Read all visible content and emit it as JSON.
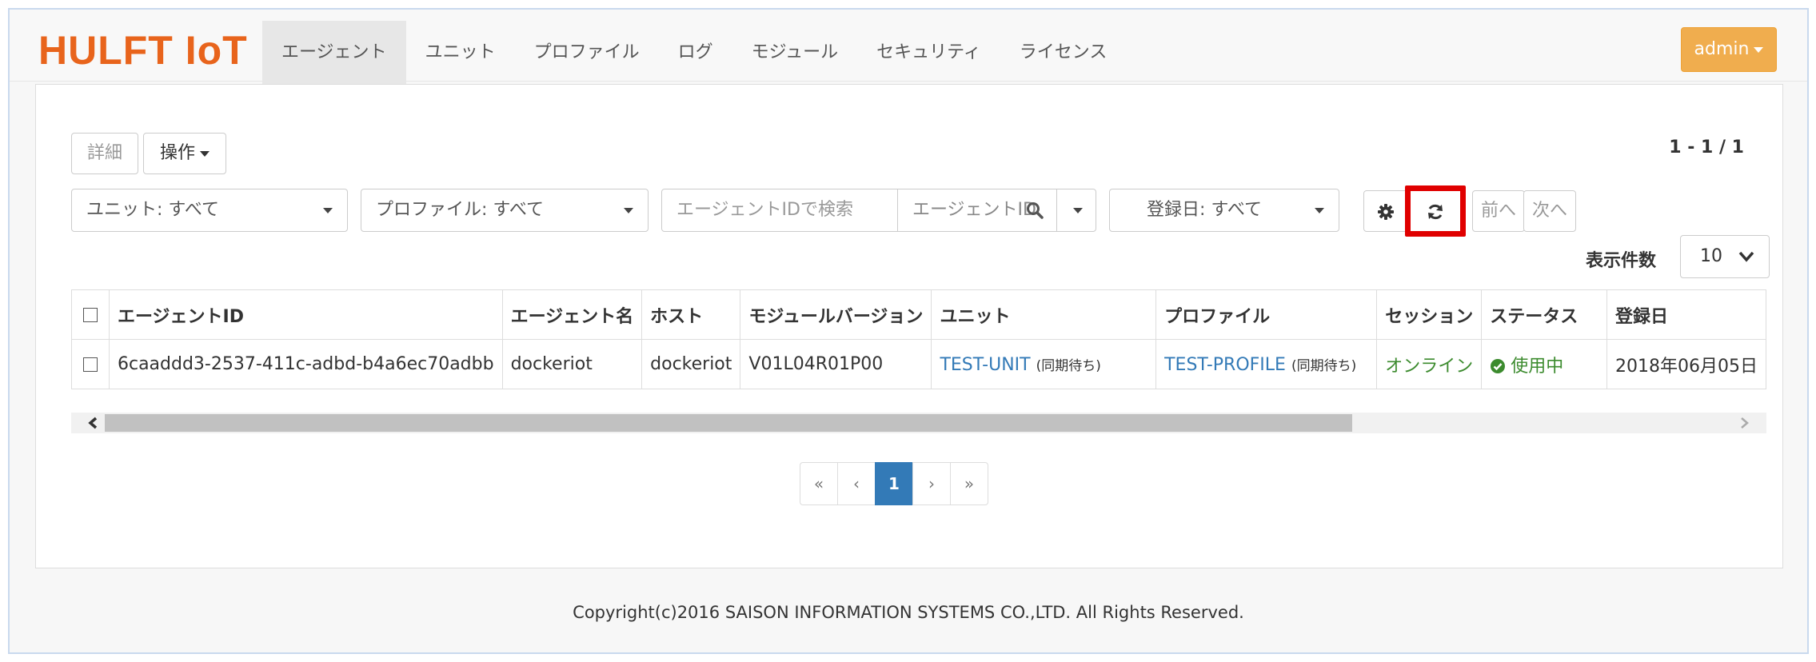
{
  "brand": "HULFT IoT",
  "nav": [
    "エージェント",
    "ユニット",
    "プロファイル",
    "ログ",
    "モジュール",
    "セキュリティ",
    "ライセンス"
  ],
  "admin_label": "admin",
  "toolbar": {
    "detail_label": "詳細",
    "operation_label": "操作",
    "count_text": "1 - 1 / 1",
    "unit_filter": "ユニット: すべて",
    "profile_filter": "プロファイル: すべて",
    "search_placeholder": "エージェントIDで検索",
    "search_field": "エージェントID",
    "date_filter": "登録日: すべて",
    "prev_label": "前へ",
    "next_label": "次へ",
    "page_size_label": "表示件数",
    "page_size_value": "10"
  },
  "table": {
    "headers": [
      "エージェントID",
      "エージェント名",
      "ホスト",
      "モジュールバージョン",
      "ユニット",
      "プロファイル",
      "セッション",
      "ステータス",
      "登録日"
    ],
    "row": {
      "agent_id": "6caaddd3-2537-411c-adbd-b4a6ec70adbb",
      "agent_name": "dockeriot",
      "host": "dockeriot",
      "module_version": "V01L04R01P00",
      "unit": "TEST-UNIT",
      "unit_note": "(同期待ち)",
      "profile": "TEST-PROFILE",
      "profile_note": "(同期待ち)",
      "session": "オンライン",
      "status": "使用中",
      "registered": "2018年06月05日"
    }
  },
  "pagination": [
    "«",
    "‹",
    "1",
    "›",
    "»"
  ],
  "footer": "Copyright(c)2016 SAISON INFORMATION SYSTEMS CO.,LTD. All Rights Reserved.",
  "colors": {
    "brand": "#e8641c",
    "admin": "#f0ad4e",
    "link": "#337ab7",
    "online": "#3c8b2e",
    "highlight": "#e00000"
  }
}
